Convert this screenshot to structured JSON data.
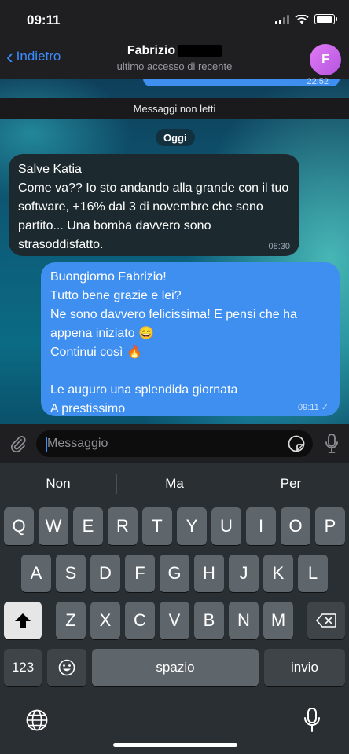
{
  "status": {
    "time": "09:11"
  },
  "header": {
    "back_label": "Indietro",
    "title": "Fabrizio",
    "subtitle": "ultimo accesso di recente",
    "avatar_letter": "F"
  },
  "chat": {
    "previous_time": "22:52",
    "unread_label": "Messaggi non letti",
    "date_label": "Oggi",
    "incoming": {
      "text": "Salve Katia\nCome va?? Io sto andando alla grande con il tuo software, +16% dal 3 di novembre che sono partito... Una bomba davvero sono strasoddisfatto.",
      "time": "08:30"
    },
    "outgoing": {
      "text": "Buongiorno Fabrizio!\nTutto bene grazie e lei?\nNe sono davvero felicissima! E pensi che ha appena iniziato 😄\nContinui così 🔥\n\nLe auguro una splendida giornata\nA prestissimo",
      "time": "09:11"
    }
  },
  "input": {
    "placeholder": "Messaggio"
  },
  "keyboard": {
    "suggestions": [
      "Non",
      "Ma",
      "Per"
    ],
    "row1": [
      "Q",
      "W",
      "E",
      "R",
      "T",
      "Y",
      "U",
      "I",
      "O",
      "P"
    ],
    "row2": [
      "A",
      "S",
      "D",
      "F",
      "G",
      "H",
      "J",
      "K",
      "L"
    ],
    "row3": [
      "Z",
      "X",
      "C",
      "V",
      "B",
      "N",
      "M"
    ],
    "numbers_label": "123",
    "space_label": "spazio",
    "return_label": "invio"
  },
  "colors": {
    "accent": "#3a8cff",
    "outgoing_bubble": "#3f8ff0",
    "incoming_bubble": "#1c2a2f"
  },
  "icons": [
    "back-chevron-icon",
    "paperclip-icon",
    "sticker-icon",
    "microphone-icon",
    "shift-icon",
    "backspace-icon",
    "emoji-icon",
    "globe-icon"
  ]
}
